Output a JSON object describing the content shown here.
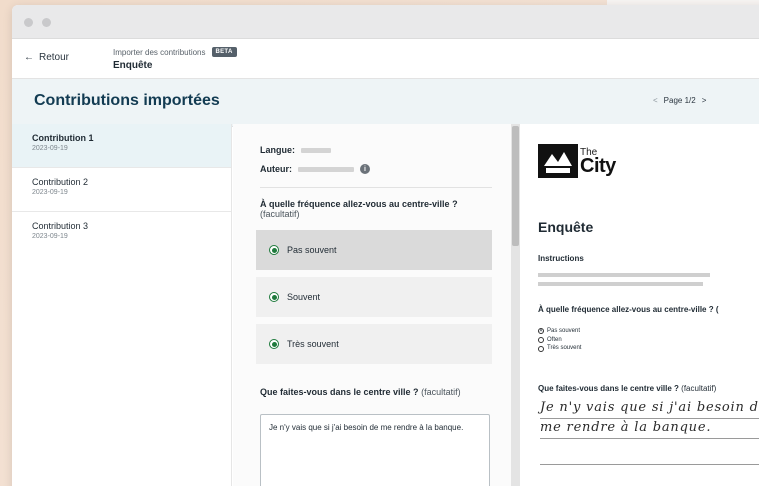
{
  "topbar": {
    "back_label": "Retour",
    "breadcrumb_parent": "Importer des contributions",
    "badge": "BETA",
    "breadcrumb_current": "Enquête"
  },
  "header": {
    "title": "Contributions importées",
    "pager": "Page 1/2"
  },
  "sidebar": {
    "items": [
      {
        "label": "Contribution 1",
        "date": "2023-09-19"
      },
      {
        "label": "Contribution 2",
        "date": "2023-09-19"
      },
      {
        "label": "Contribution 3",
        "date": "2023-09-19"
      }
    ]
  },
  "form": {
    "language_label": "Langue:",
    "author_label": "Auteur:",
    "question1": "À quelle fréquence allez-vous au centre-ville ?",
    "question1_optional": "(facultatif)",
    "choices": [
      "Pas souvent",
      "Souvent",
      "Très souvent"
    ],
    "question2": "Que faites-vous dans le centre ville ?",
    "question2_optional": "(facultatif)",
    "answer2": "Je n'y vais que si j'ai besoin de me rendre à la banque."
  },
  "preview": {
    "logo_the": "The",
    "logo_city": "City",
    "title": "Enquête",
    "instructions_label": "Instructions",
    "question1": "À quelle fréquence allez-vous au centre-ville ? (",
    "options": [
      "Pas souvent",
      "Often",
      "Très souvent"
    ],
    "question2": "Que faites-vous dans le centre ville ?",
    "question2_optional": "(facultatif)",
    "handwriting_line1": "Je n'y vais que si j'ai besoin d",
    "handwriting_line2": "me rendre à la banque."
  },
  "colors": {
    "accent_green": "#1e7a3c",
    "title_blue": "#123b52",
    "header_bg": "#eef4f6"
  }
}
